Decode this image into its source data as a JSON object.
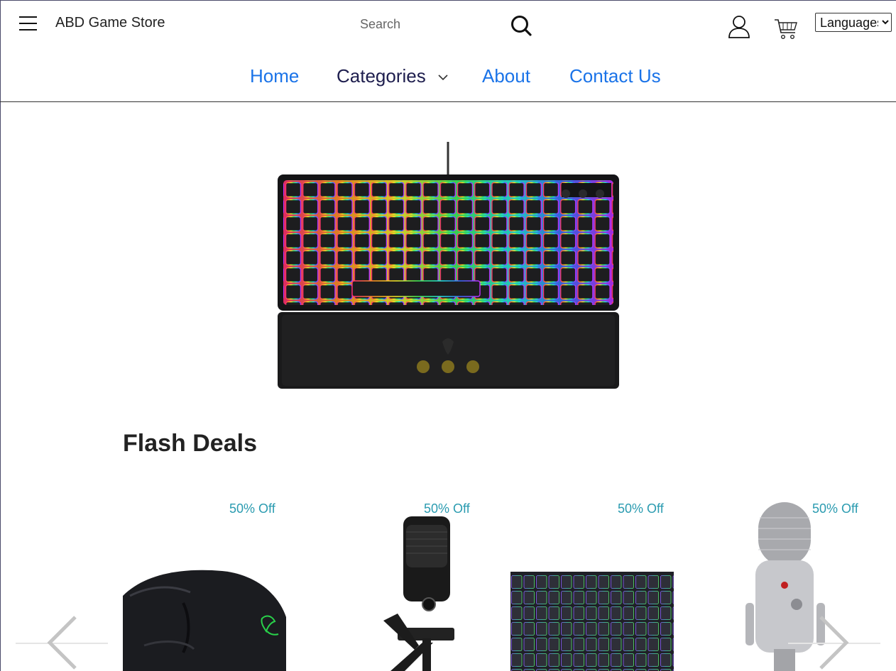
{
  "header": {
    "brand": "ABD Game Store",
    "search_placeholder": "Search",
    "language_selected": "Languages"
  },
  "icons": {
    "menu": "hamburger-icon",
    "search": "search-icon",
    "account": "user-icon",
    "cart": "cart-icon",
    "dropdown": "chevron-down-icon",
    "prev": "chevron-left-icon",
    "next": "chevron-right-icon"
  },
  "nav": {
    "home": "Home",
    "categories": "Categories",
    "about": "About",
    "contact": "Contact Us"
  },
  "colors": {
    "nav_link": "#1a73e8",
    "nav_active": "#1e1e4e",
    "badge": "#2a9bb0",
    "carousel_dot": "#7a6a1e"
  },
  "hero": {
    "slide_count": 3,
    "image": "rgb-keyboard-with-wrist-rest"
  },
  "flash_deals": {
    "title": "Flash Deals",
    "products": [
      {
        "badge": "50% Off",
        "image": "gaming-mouse"
      },
      {
        "badge": "50% Off",
        "image": "black-microphone"
      },
      {
        "badge": "50% Off",
        "image": "mechanical-keyboard"
      },
      {
        "badge": "50% Off",
        "image": "silver-microphone"
      }
    ]
  }
}
